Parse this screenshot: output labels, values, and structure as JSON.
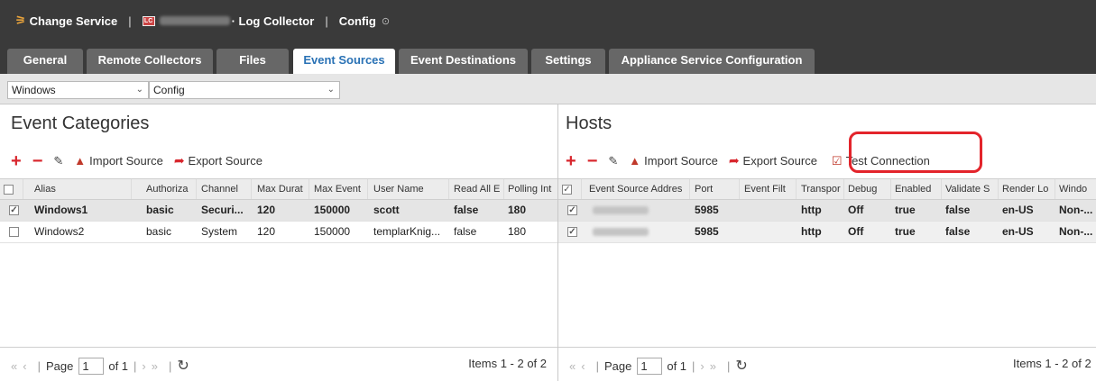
{
  "topbar": {
    "change_service": "Change Service",
    "lc_badge": "LC",
    "service_name": "· Log Collector",
    "config": "Config"
  },
  "tabs": [
    "General",
    "Remote Collectors",
    "Files",
    "Event Sources",
    "Event Destinations",
    "Settings",
    "Appliance Service Configuration"
  ],
  "active_tab": "Event Sources",
  "filters": {
    "source_type": "Windows",
    "view": "Config"
  },
  "left_panel": {
    "title": "Event Categories",
    "toolbar": {
      "import": "Import Source",
      "export": "Export Source"
    },
    "columns": [
      "Alias",
      "Authoriza",
      "Channel",
      "Max Durat",
      "Max Event",
      "User Name",
      "Read All E",
      "Polling Int"
    ],
    "rows": [
      {
        "checked": true,
        "cells": [
          "Windows1",
          "basic",
          "Securi...",
          "120",
          "150000",
          "scott",
          "false",
          "180"
        ]
      },
      {
        "checked": false,
        "cells": [
          "Windows2",
          "basic",
          "System",
          "120",
          "150000",
          "templarKnig...",
          "false",
          "180"
        ]
      }
    ],
    "pager": {
      "page_label": "Page",
      "page_value": "1",
      "of_label": "of 1",
      "items": "Items 1 - 2 of 2"
    }
  },
  "right_panel": {
    "title": "Hosts",
    "toolbar": {
      "import": "Import Source",
      "export": "Export Source",
      "test": "Test Connection"
    },
    "columns": [
      "Event Source Addres",
      "Port",
      "Event Filt",
      "Transpor",
      "Debug",
      "Enabled",
      "Validate S",
      "Render Lo",
      "Windo"
    ],
    "rows": [
      {
        "checked": true,
        "cells": [
          "",
          "5985",
          "",
          "http",
          "Off",
          "true",
          "false",
          "en-US",
          "Non-..."
        ]
      },
      {
        "checked": true,
        "cells": [
          "",
          "5985",
          "",
          "http",
          "Off",
          "true",
          "false",
          "en-US",
          "Non-..."
        ]
      }
    ],
    "pager": {
      "page_label": "Page",
      "page_value": "1",
      "of_label": "of 1",
      "items": "Items 1 - 2 of 2"
    }
  },
  "colors": {
    "topbar": "#3a3a3a",
    "tab": "#676767",
    "active_tab_text": "#2a72b5",
    "accent_red": "#d8262d",
    "highlight": "#e3242b"
  },
  "icons": {
    "add": "plus-icon",
    "remove": "minus-icon",
    "edit": "edit-icon",
    "import": "import-icon",
    "export": "export-icon",
    "test": "test-connection-icon",
    "refresh": "refresh-icon",
    "dropdown": "chevron-down-icon"
  }
}
